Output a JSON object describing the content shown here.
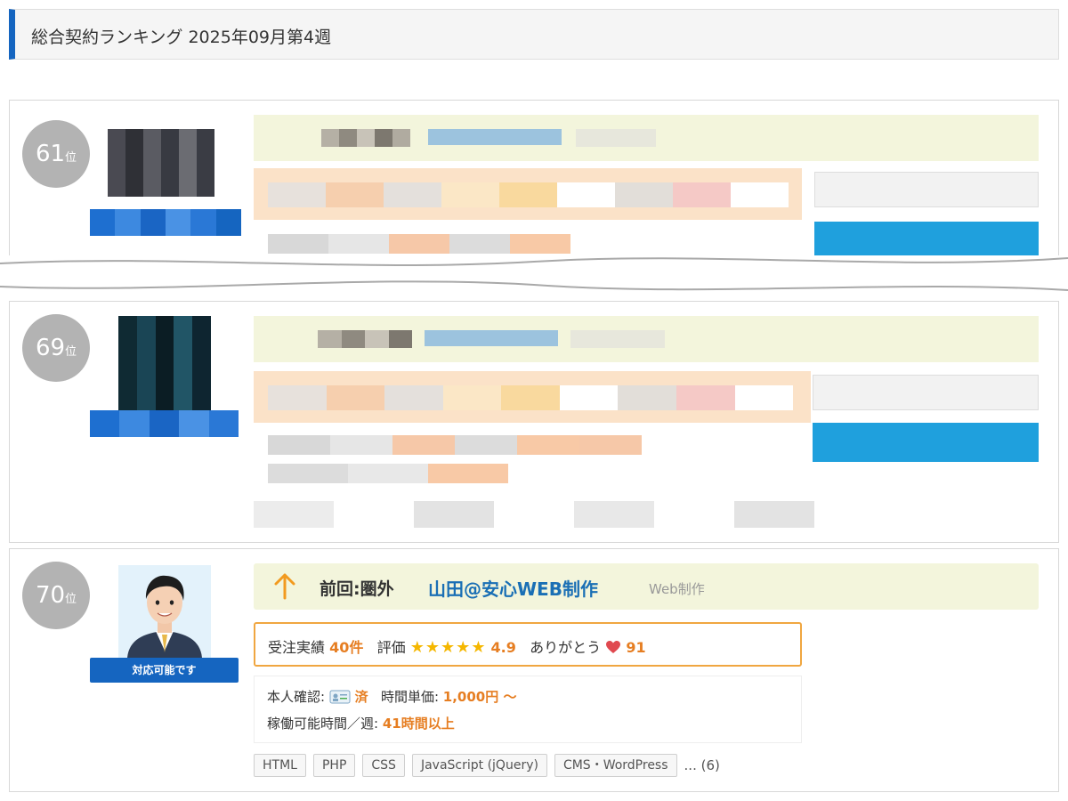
{
  "header": {
    "title": "総合契約ランキング 2025年09月第4週"
  },
  "ranks": [
    {
      "rank": "61",
      "suffix": "位"
    },
    {
      "rank": "69",
      "suffix": "位"
    },
    {
      "rank": "70",
      "suffix": "位"
    }
  ],
  "entry70": {
    "avail_badge": "対応可能です",
    "prev_rank": "前回:圏外",
    "name": "山田@安心WEB制作",
    "category": "Web制作",
    "stats": {
      "orders_label": "受注実績",
      "orders_value": "40件",
      "rating_label": "評価",
      "stars": "★★★★★",
      "rating_value": "4.9",
      "thanks_label": "ありがとう",
      "thanks_value": "91"
    },
    "info": {
      "id_label": "本人確認:",
      "id_value": "済",
      "rate_label": "時間単価:",
      "rate_value": "1,000円 〜",
      "hours_label": "稼働可能時間／週:",
      "hours_value": "41時間以上"
    },
    "tags": [
      "HTML",
      "PHP",
      "CSS",
      "JavaScript (jQuery)",
      "CMS・WordPress"
    ],
    "tags_more": "... (6)"
  },
  "colors": {
    "accent": "#1565c0",
    "rank_circle": "#b3b3b3",
    "orange": "#e67e22",
    "link_blue": "#1a6fb5",
    "top_bar_bg": "#f3f5dc",
    "stats_border": "#f0a640"
  }
}
